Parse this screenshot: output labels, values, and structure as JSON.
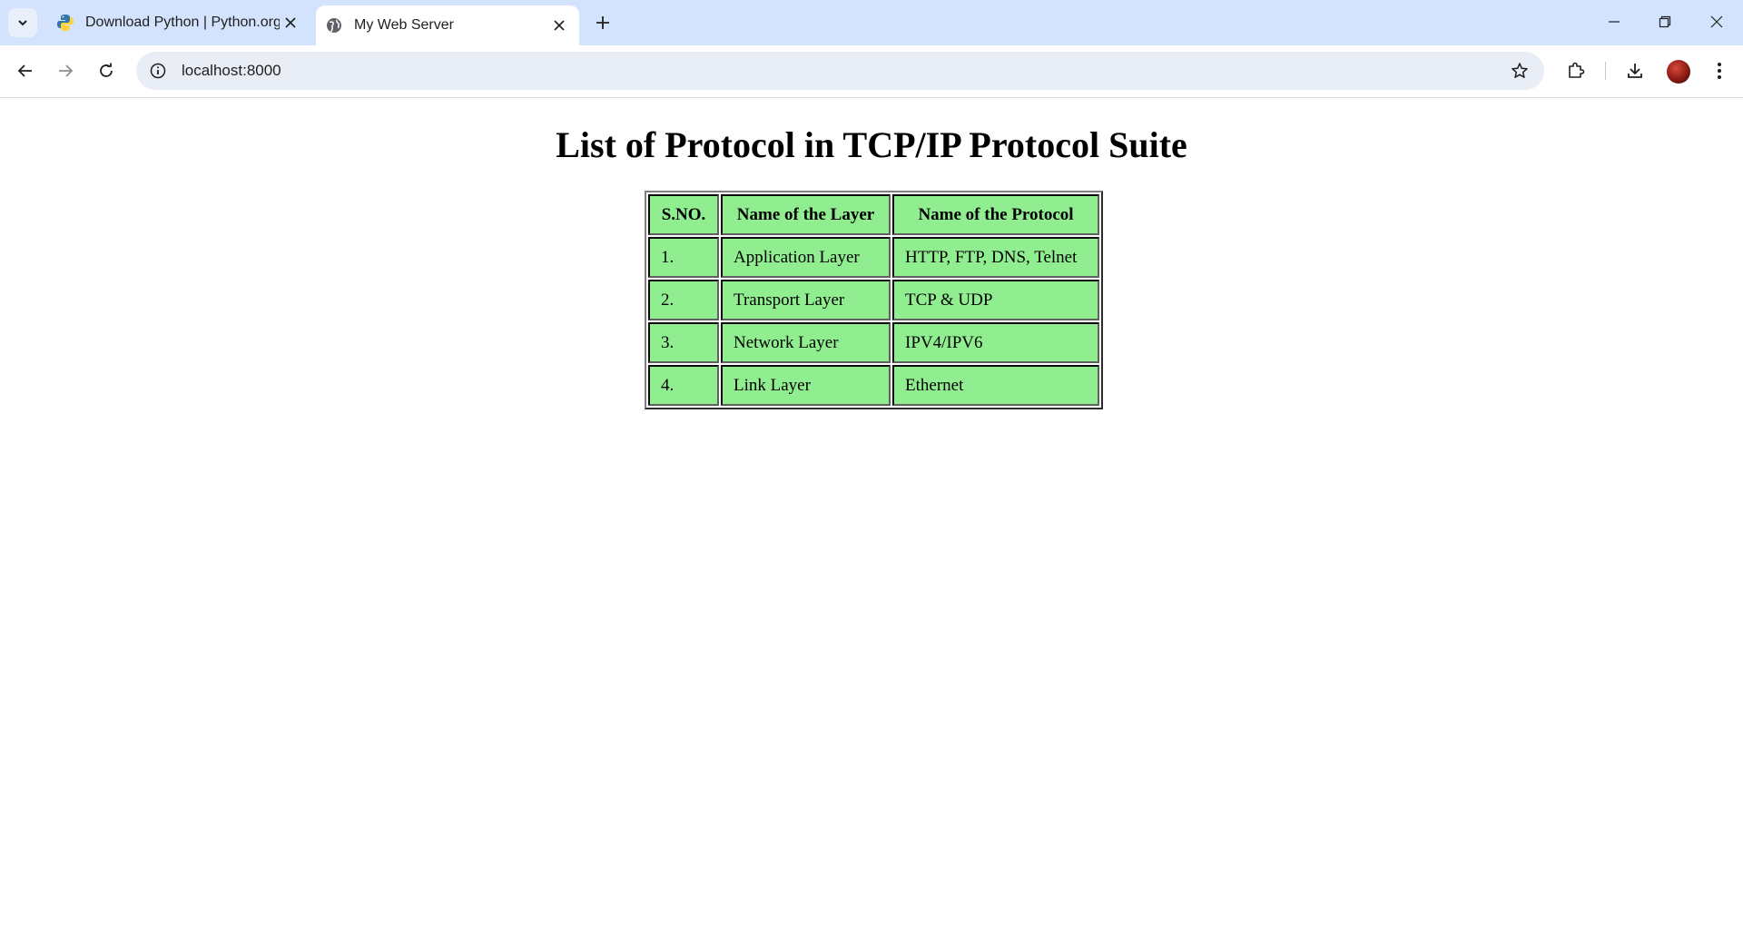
{
  "browser": {
    "tabs": [
      {
        "title": "Download Python | Python.org",
        "favicon": "python-icon",
        "active": false
      },
      {
        "title": "My Web Server",
        "favicon": "globe-icon",
        "active": true
      }
    ],
    "address_bar": {
      "url": "localhost:8000"
    }
  },
  "page": {
    "heading": "List of Protocol in TCP/IP Protocol Suite",
    "table": {
      "headers": [
        "S.NO.",
        "Name of the Layer",
        "Name of the Protocol"
      ],
      "rows": [
        [
          "1.",
          "Application Layer",
          "HTTP, FTP, DNS, Telnet"
        ],
        [
          "2.",
          "Transport Layer",
          "TCP & UDP"
        ],
        [
          "3.",
          "Network Layer",
          "IPV4/IPV6"
        ],
        [
          "4.",
          "Link Layer",
          "Ethernet"
        ]
      ],
      "cell_color": "#90ee90"
    }
  },
  "colors": {
    "tabstrip": "#d3e3fd",
    "omnibox": "#e9eef6"
  }
}
